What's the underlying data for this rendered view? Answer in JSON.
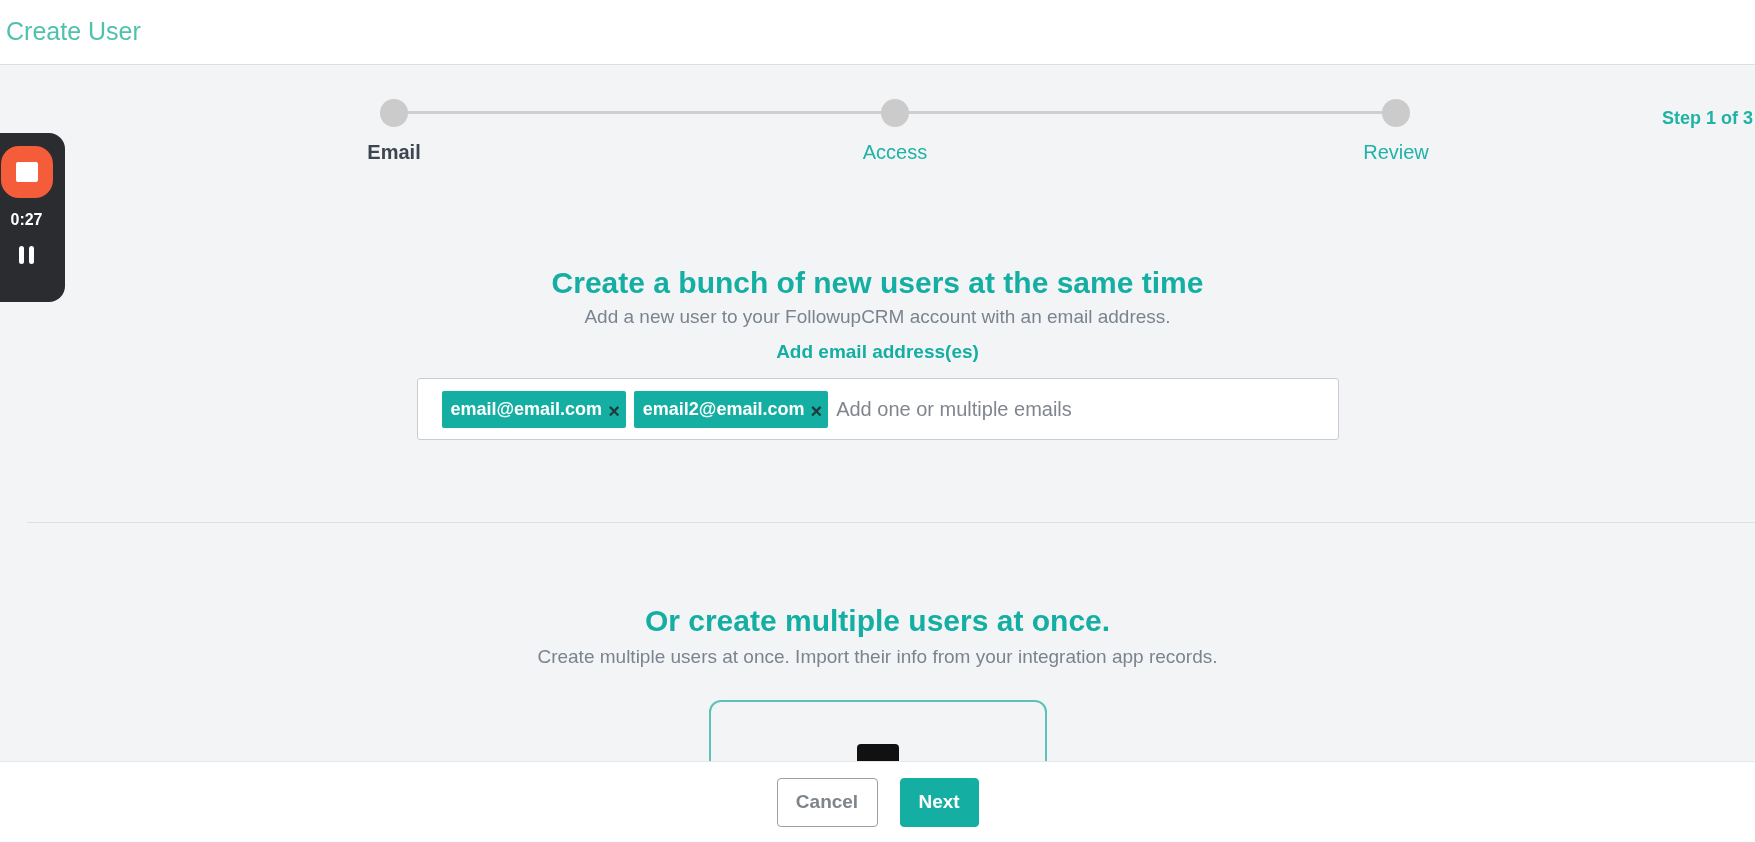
{
  "header": {
    "title": "Create User"
  },
  "stepper": {
    "steps": [
      {
        "label": "Email",
        "selected": true
      },
      {
        "label": "Access",
        "selected": false
      },
      {
        "label": "Review",
        "selected": false
      }
    ],
    "counter": "Step 1 of 3"
  },
  "recorder": {
    "time": "0:27"
  },
  "single": {
    "title": "Create a bunch of new users at the same time",
    "subtitle": "Add a new user to your FollowupCRM account with an email address.",
    "field_label": "Add email address(es)",
    "tags": [
      "email@email.com",
      "email2@email.com"
    ],
    "placeholder": "Add one or multiple emails",
    "remove_glyph": "×"
  },
  "multiple": {
    "title": "Or create multiple users at once.",
    "subtitle": "Create multiple users at once. Import their info from your integration app records."
  },
  "footer": {
    "buttons": [
      {
        "label": "Cancel",
        "kind": "secondary"
      },
      {
        "label": "Next",
        "kind": "primary"
      }
    ]
  }
}
